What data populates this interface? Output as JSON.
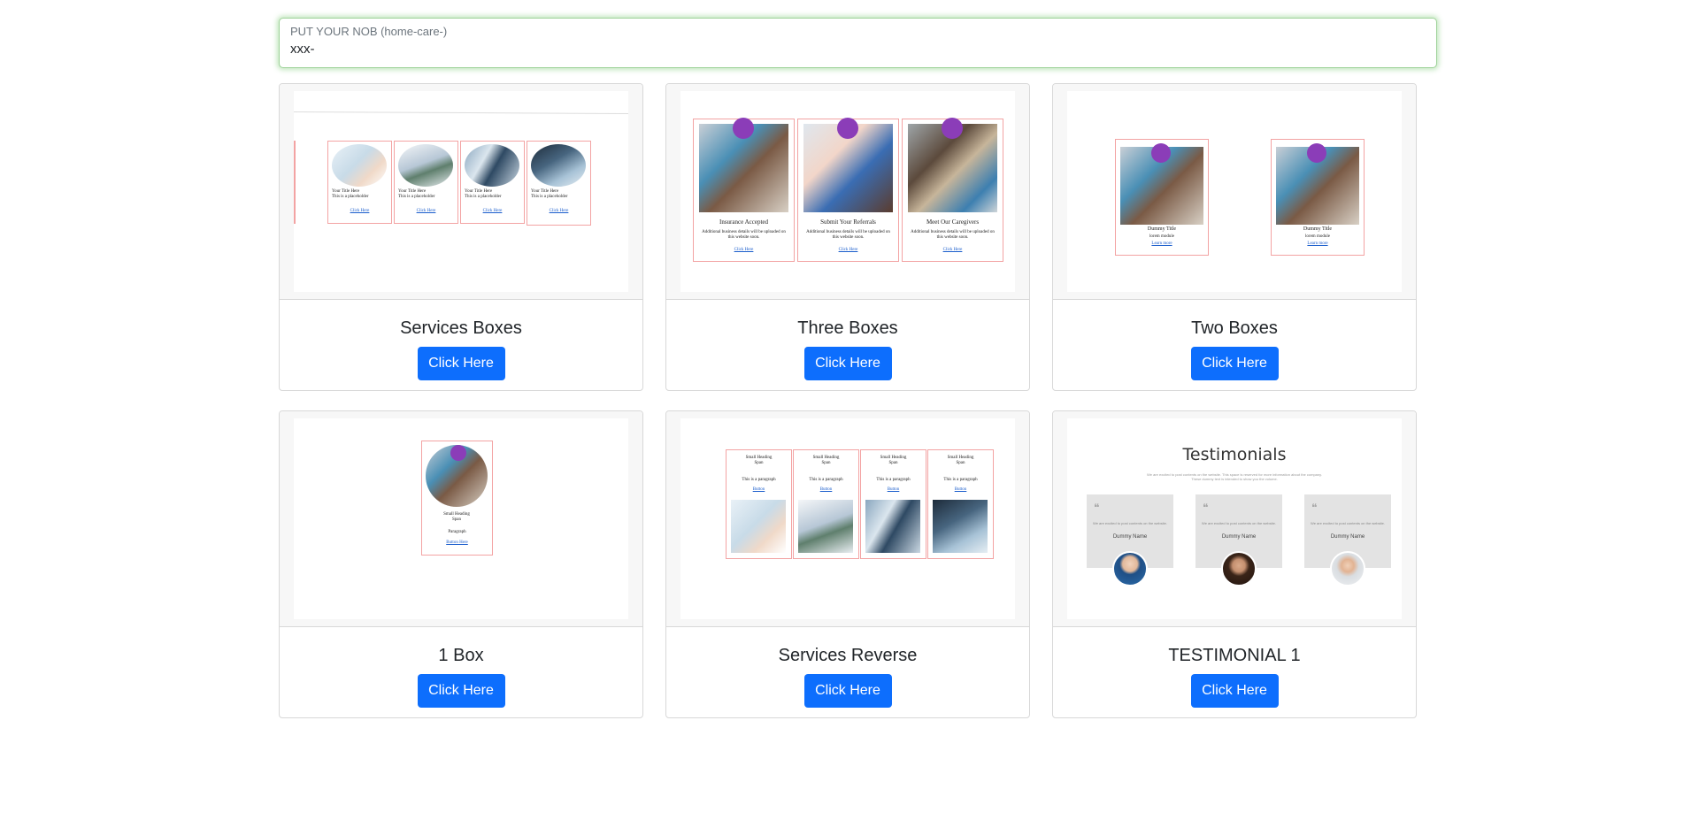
{
  "nob": {
    "label": "PUT YOUR NOB (home-care-)",
    "value": "xxx-"
  },
  "cards": [
    {
      "title": "Services Boxes",
      "button": "Click Here",
      "thumb": {
        "box_title": "Your Title Here",
        "box_text": "This is a placeholder",
        "box_link": "Click Here"
      }
    },
    {
      "title": "Three Boxes",
      "button": "Click Here",
      "thumb": {
        "boxes": [
          {
            "title": "Insurance Accepted",
            "text": "Additional business details will be uploaded on this website soon.",
            "link": "Click Here"
          },
          {
            "title": "Submit Your Referrals",
            "text": "Additional business details will be uploaded on this website soon.",
            "link": "Click Here"
          },
          {
            "title": "Meet Our Caregivers",
            "text": "Additional business details will be uploaded on this website soon.",
            "link": "Click Here"
          }
        ]
      }
    },
    {
      "title": "Two Boxes",
      "button": "Click Here",
      "thumb": {
        "box_title": "Dummy Title",
        "box_text": "lorem module",
        "box_link": "Learn more"
      }
    },
    {
      "title": "1 Box",
      "button": "Click Here",
      "thumb": {
        "box_title": "Small Heading Span",
        "box_text": "Paragraph",
        "box_link": "Button Here"
      }
    },
    {
      "title": "Services Reverse",
      "button": "Click Here",
      "thumb": {
        "box_title": "Small Heading Span",
        "box_text": "This is a paragraph",
        "box_link": "Button"
      }
    },
    {
      "title": "TESTIMONIAL 1",
      "button": "Click Here",
      "thumb": {
        "heading": "Testimonials",
        "subtext": "We are excited to post contents on the website. This space is reserved for more information about the company. These dummy text is intended to show you the volume.",
        "quote_text": "We are excited to post contents on the website.",
        "name": "Dummy Name"
      }
    }
  ],
  "colors": {
    "button": "#0d6efd",
    "badge": "#8b3db8",
    "box_border": "#f3a3a3",
    "nob_glow": "#9fd39a"
  }
}
